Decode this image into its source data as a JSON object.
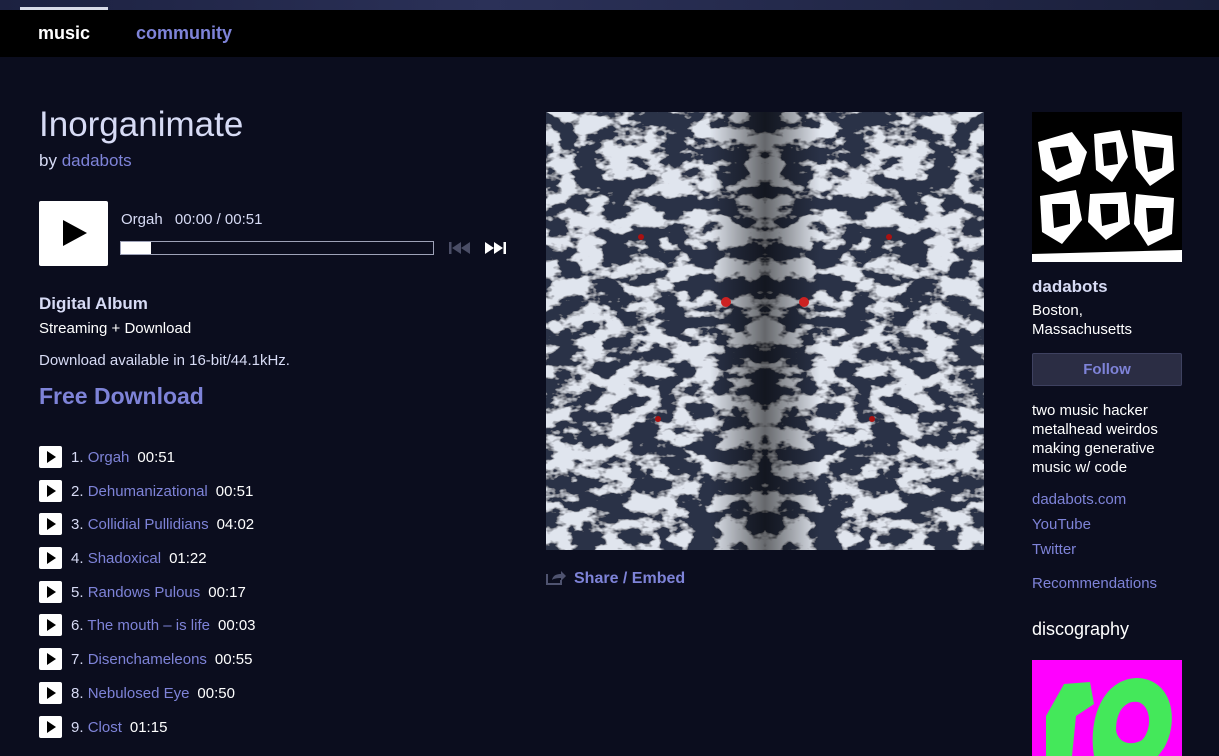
{
  "nav": {
    "tabs": [
      {
        "label": "music"
      },
      {
        "label": "community"
      }
    ]
  },
  "album": {
    "title": "Inorganimate",
    "by_prefix": "by",
    "artist": "dadabots"
  },
  "player": {
    "current_track": "Orgah",
    "time": "00:00 / 00:51",
    "progress_fraction": 0.0,
    "prev_icon": "previous-track-icon",
    "next_icon": "next-track-icon"
  },
  "purchase": {
    "format": "Digital Album",
    "formats_note": "Streaming + Download",
    "quality_note": "Download available in 16-bit/44.1kHz.",
    "free_download": "Free Download"
  },
  "tracks": [
    {
      "num": "1.",
      "title": "Orgah",
      "duration": "00:51"
    },
    {
      "num": "2.",
      "title": "Dehumanizational",
      "duration": "00:51"
    },
    {
      "num": "3.",
      "title": "Collidial Pullidians",
      "duration": "04:02"
    },
    {
      "num": "4.",
      "title": "Shadoxical",
      "duration": "01:22"
    },
    {
      "num": "5.",
      "title": "Randows Pulous",
      "duration": "00:17"
    },
    {
      "num": "6.",
      "title": "The mouth – is life",
      "duration": "00:03"
    },
    {
      "num": "7.",
      "title": "Disenchameleons",
      "duration": "00:55"
    },
    {
      "num": "8.",
      "title": "Nebulosed Eye",
      "duration": "00:50"
    },
    {
      "num": "9.",
      "title": "Clost",
      "duration": "01:15"
    }
  ],
  "share": {
    "label": "Share / Embed",
    "icon": "share-icon"
  },
  "artist_panel": {
    "name": "dadabots",
    "location_line1": "Boston,",
    "location_line2": "Massachusetts",
    "follow_label": "Follow",
    "bio": "two music hacker metalhead weirdos making generative music w/ code",
    "links": [
      "dadabots.com",
      "YouTube",
      "Twitter"
    ],
    "recommendations": "Recommendations",
    "discography_title": "discography"
  },
  "colors": {
    "background": "#0b0d1e",
    "link": "#7e83d8",
    "text_light": "#d7dbf5",
    "discography_thumb": "#ff00ff",
    "discography_glyph": "#44e85a"
  }
}
